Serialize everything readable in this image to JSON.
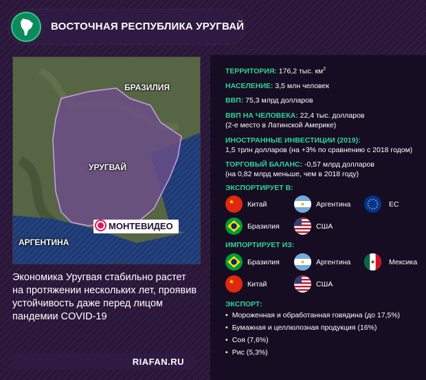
{
  "header": {
    "title": "ВОСТОЧНАЯ РЕСПУБЛИКА УРУГВАЙ"
  },
  "map": {
    "labels": {
      "brazil": "БРАЗИЛИЯ",
      "uruguay": "УРУГВАЙ",
      "argentina": "АРГЕНТИНА"
    },
    "capital": "МОНТЕВИДЕО"
  },
  "caption": "Экономика Уругвая стабильно растет на протяжении нескольких лет, проявив устойчивость даже перед лицом пандемии COVID-19",
  "source": "RIAFAN.RU",
  "facts": {
    "territory_key": "ТЕРРИТОРИЯ:",
    "territory_val": " 176,2 тыс. км",
    "territory_sup": "2",
    "population_key": "НАСЕЛЕНИЕ:",
    "population_val": " 3,5 млн человек",
    "gdp_key": "ВВП:",
    "gdp_val": " 75,3 млрд долларов",
    "gdp_pc_key": "ВВП НА ЧЕЛОВЕКА:",
    "gdp_pc_val": " 22,4 тыс. долларов",
    "gdp_pc_note": "(2-е место в Латинской Америке)",
    "fdi_key": "ИНОСТРАННЫЕ ИНВЕСТИЦИИ (2019):",
    "fdi_val": "1,5 трлн долларов (на +3% по сравнению с 2018 годом)",
    "trade_key": "ТОРГОВЫЙ БАЛАНС:",
    "trade_val": " -0,57 млрд долларов",
    "trade_note": "(на 0,82 млрд меньше, чем в 2018 году)"
  },
  "exports_to": {
    "title": "ЭКСПОРТИРУЕТ В:",
    "items": [
      "Китай",
      "Аргентина",
      "ЕС",
      "Бразилия",
      "США"
    ]
  },
  "imports_from": {
    "title": "ИМПОРТИРУЕТ ИЗ:",
    "items": [
      "Бразилия",
      "Аргентина",
      "Мексика",
      "Китай",
      "США"
    ]
  },
  "export_goods": {
    "title": "ЭКСПОРТ:",
    "items": [
      "Мороженная и обработанная говядина (до 17,5%)",
      "Бумажная и целлюлозная продукция (16%)",
      "Соя (7,6%)",
      "Рис (5,3%)"
    ]
  },
  "colors": {
    "accent": "#2fd596",
    "background": "#2a1639",
    "panel": "#170d22"
  }
}
